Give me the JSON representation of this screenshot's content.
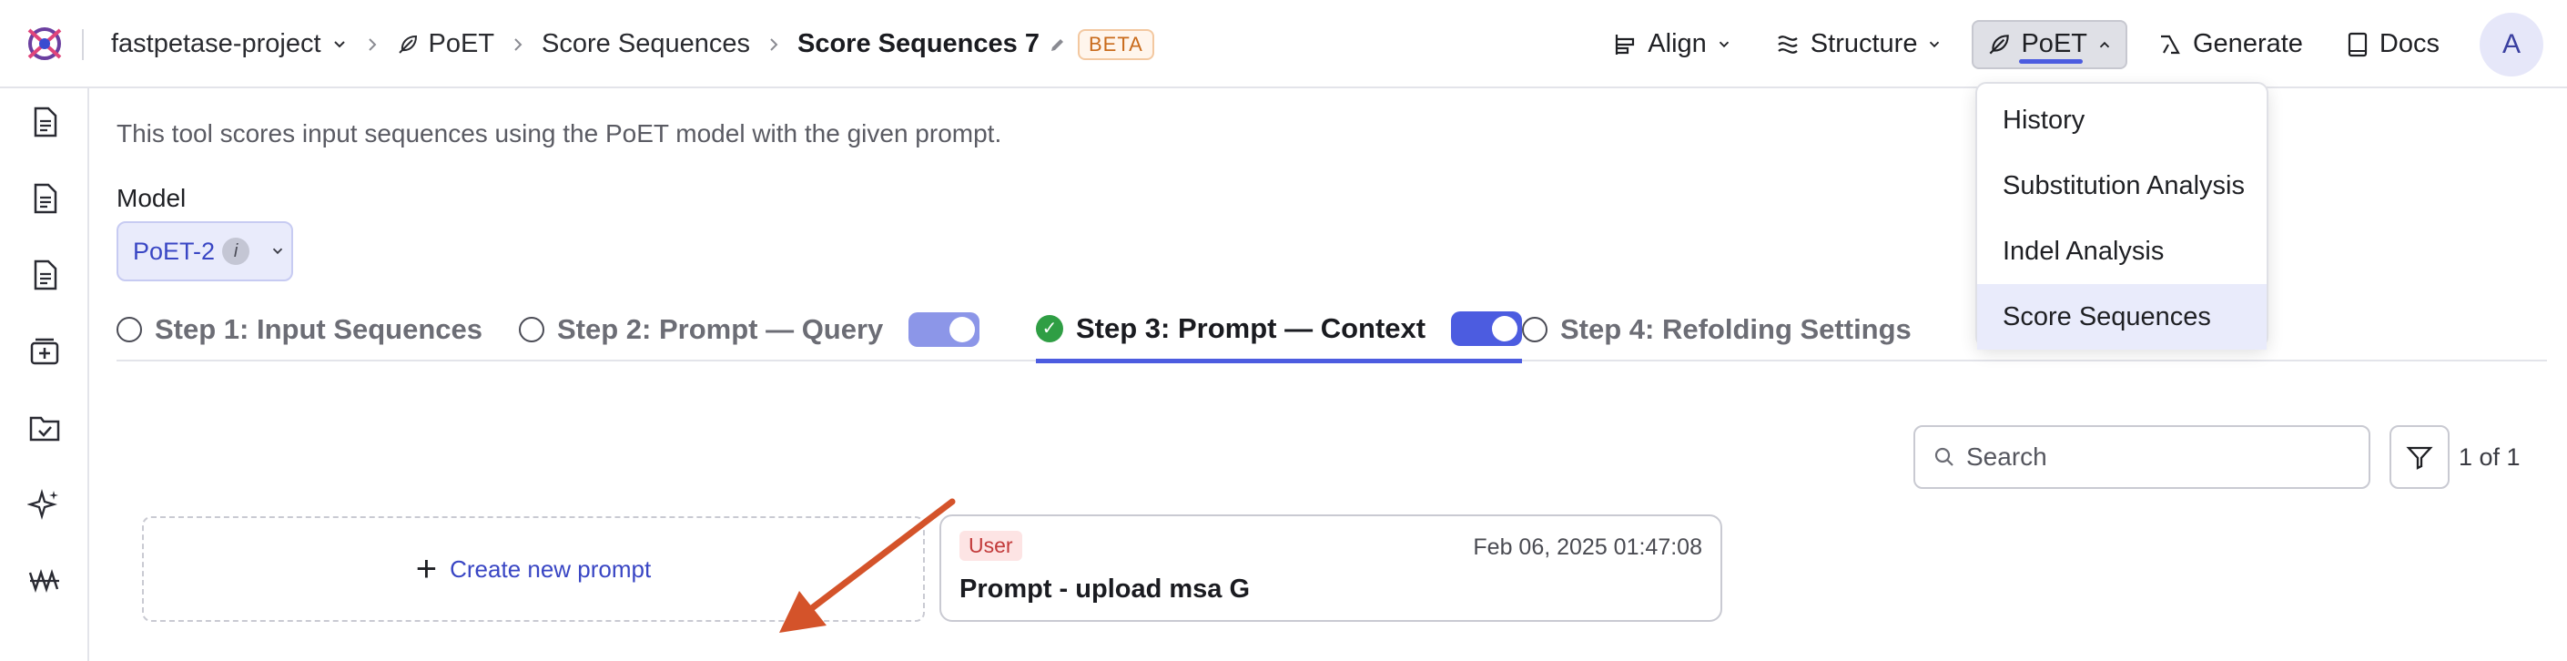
{
  "breadcrumb": {
    "project": "fastpetase-project",
    "tool": "PoET",
    "section": "Score Sequences",
    "current": "Score Sequences 7",
    "badge": "BETA"
  },
  "nav": {
    "align": "Align",
    "structure": "Structure",
    "poet": "PoET",
    "generate": "Generate",
    "docs": "Docs",
    "avatar_initial": "A"
  },
  "dropdown": {
    "items": [
      "History",
      "Substitution Analysis",
      "Indel Analysis",
      "Score Sequences"
    ],
    "selected": "Score Sequences"
  },
  "main": {
    "description": "This tool scores input sequences using the PoET model with the given prompt.",
    "model_label": "Model",
    "model_value": "PoET-2",
    "info_glyph": "i"
  },
  "steps": [
    {
      "label": "Step 1: Input Sequences",
      "state": "incomplete"
    },
    {
      "label": "Step 2: Prompt — Query",
      "state": "incomplete",
      "toggle": true
    },
    {
      "label": "Step 3: Prompt — Context",
      "state": "complete",
      "toggle": true
    },
    {
      "label": "Step 4: Refolding Settings",
      "state": "incomplete"
    }
  ],
  "search": {
    "placeholder": "Search"
  },
  "pagination": "1 of 1",
  "create_prompt": "Create new prompt",
  "prompt_card": {
    "tag": "User",
    "date": "Feb 06, 2025 01:47:08",
    "title": "Prompt - upload msa G"
  },
  "colors": {
    "accent": "#4c5ce0",
    "arrow": "#d4532a",
    "beta": "#c96b1c",
    "success": "#2f9e44"
  }
}
